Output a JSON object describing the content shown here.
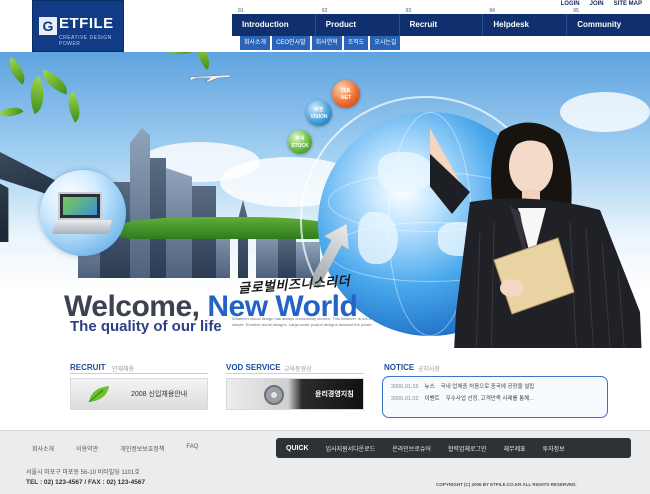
{
  "brand": {
    "logo_text": "ETFILE",
    "logo_mark": "G",
    "logo_sub": "CREATIVE DESIGN POWER"
  },
  "util_nav": [
    "LOGIN",
    "JOIN",
    "SITE MAP"
  ],
  "main_nav": [
    {
      "num": "01",
      "label": "Introduction"
    },
    {
      "num": "02",
      "label": "Product"
    },
    {
      "num": "03",
      "label": "Recruit"
    },
    {
      "num": "04",
      "label": "Helpdesk"
    },
    {
      "num": "05",
      "label": "Community"
    }
  ],
  "sub_nav": [
    "회사소개",
    "CEO인사말",
    "회사연혁",
    "조직도",
    "오시는길"
  ],
  "hero": {
    "korean_title": "글로벌비즈니스리더",
    "welcome_prefix": "Welcome, ",
    "welcome_highlight": "New World",
    "tagline": "The quality of our life",
    "small_text": "Whatever visual design has always consciously chosen. This however, is not a simple. Emotive visual designs. Large-scale project designs demand the power",
    "balls": [
      {
        "top": "대표",
        "label": "NET",
        "color": "#e9672a"
      },
      {
        "top": "비전",
        "label": "VISION",
        "color": "#3b9ad6"
      },
      {
        "top": "주식",
        "label": "STOCK",
        "color": "#5fb53b"
      }
    ]
  },
  "recruit": {
    "title": "RECRUIT",
    "sub": "인재채용",
    "banner": "2008 신입채용안내"
  },
  "vod": {
    "title": "VOD SERVICE",
    "sub": "교육동영상",
    "banner": "윤리경영지침"
  },
  "notice": {
    "title": "NOTICE",
    "sub": "공지사항",
    "items": [
      {
        "date": "2006.01.15",
        "cat": "뉴스",
        "text": "국내 업체중 처음으로 중국에 공장을 설립"
      },
      {
        "date": "2006.01.02",
        "cat": "이벤트",
        "text": "우수사업 선정, 고객만족 사례를 통해..."
      }
    ]
  },
  "footer": {
    "links": [
      "회사소개",
      "이용약관",
      "개인정보보호정책",
      "FAQ"
    ],
    "quick_label": "QUICK",
    "quick_items": [
      "입사지원서다운로드",
      "온라인브로슈어",
      "협력업체로그인",
      "재무제표",
      "투자정보"
    ],
    "address": "서울시 마포구 마포동 56-10 비타빌딩 1101호",
    "tel": "TEL : 02) 123-4567  /  FAX : 02) 123-4567",
    "copyright": "COPYRIGHT (C) 2006 BY ETFILE.CO.KR ALL RIGHTS RESERVED."
  }
}
